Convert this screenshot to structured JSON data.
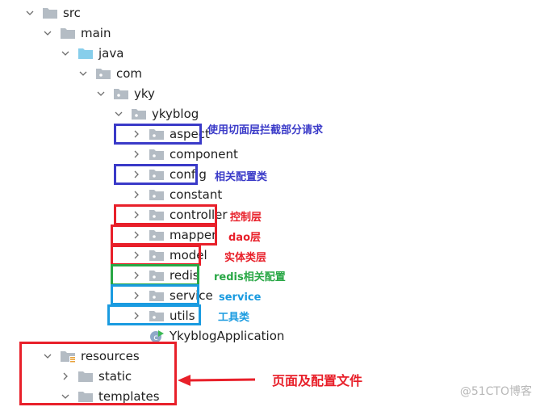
{
  "colors": {
    "blue_box": "#3a3ac8",
    "red_box": "#e8202a",
    "green_box": "#28a745",
    "cyan_box": "#1a9be0",
    "folder_gray": "#b4bcc4",
    "folder_source": "#87ceeb",
    "text": "#1f1f1f"
  },
  "tree": [
    {
      "label": "src",
      "chevron": "down",
      "icon": "folder-icon"
    },
    {
      "label": "main",
      "chevron": "down",
      "icon": "folder-icon"
    },
    {
      "label": "java",
      "chevron": "down",
      "icon": "source-folder-icon"
    },
    {
      "label": "com",
      "chevron": "down",
      "icon": "package-icon"
    },
    {
      "label": "yky",
      "chevron": "down",
      "icon": "package-icon"
    },
    {
      "label": "ykyblog",
      "chevron": "down",
      "icon": "package-icon"
    },
    {
      "label": "aspect",
      "chevron": "right",
      "icon": "package-icon"
    },
    {
      "label": "component",
      "chevron": "right",
      "icon": "package-icon"
    },
    {
      "label": "config",
      "chevron": "right",
      "icon": "package-icon"
    },
    {
      "label": "constant",
      "chevron": "right",
      "icon": "package-icon"
    },
    {
      "label": "controller",
      "chevron": "right",
      "icon": "package-icon"
    },
    {
      "label": "mapper",
      "chevron": "right",
      "icon": "package-icon"
    },
    {
      "label": "model",
      "chevron": "right",
      "icon": "package-icon"
    },
    {
      "label": "redis",
      "chevron": "right",
      "icon": "package-icon"
    },
    {
      "label": "service",
      "chevron": "right",
      "icon": "package-icon"
    },
    {
      "label": "utils",
      "chevron": "right",
      "icon": "package-icon"
    },
    {
      "label": "YkyblogApplication",
      "chevron": "none",
      "icon": "spring-boot-class-icon"
    },
    {
      "label": "resources",
      "chevron": "down",
      "icon": "resources-folder-icon"
    },
    {
      "label": "static",
      "chevron": "right",
      "icon": "folder-icon"
    },
    {
      "label": "templates",
      "chevron": "down",
      "icon": "folder-icon"
    }
  ],
  "annotations": {
    "aspect": "使用切面层拦截部分请求",
    "config": "相关配置类",
    "controller": "控制层",
    "mapper": "dao层",
    "model": "实体类层",
    "redis": "redis相关配置",
    "service": "service",
    "utils": "工具类",
    "resources": "页面及配置文件"
  },
  "watermark": "@51CTO博客"
}
